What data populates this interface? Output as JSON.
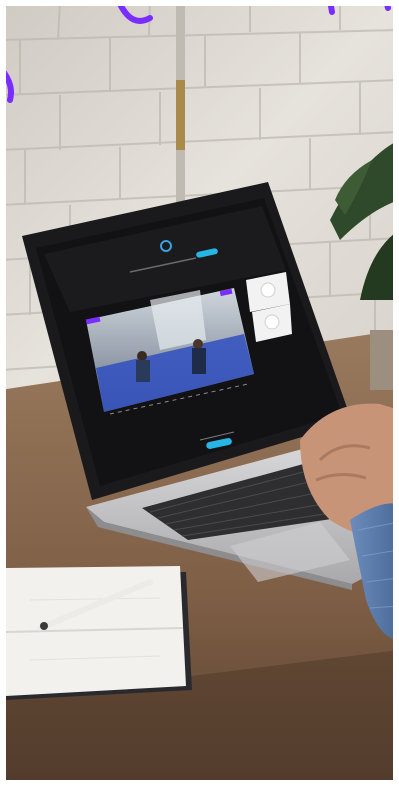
{
  "image": {
    "description_icons": [
      "laptop-icon",
      "notebook-icon",
      "pen-icon",
      "plant-icon",
      "hand-icon"
    ],
    "colors": {
      "brick_wall": "#dcd8d2",
      "desk_wood": "#8a6a4f",
      "laptop_silver": "#c9c9cb",
      "screen_black": "#111111",
      "accent_purple": "#7b2cff",
      "accent_cyan": "#27b5e6",
      "shirt_blue": "#5c7fb0"
    }
  }
}
